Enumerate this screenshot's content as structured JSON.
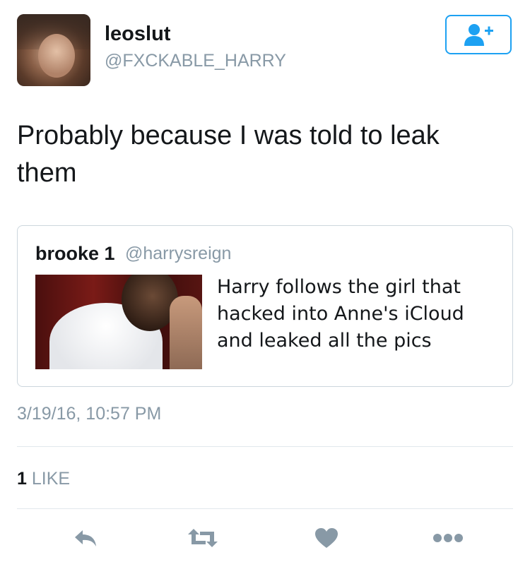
{
  "user": {
    "display_name": "leoslut",
    "handle": "@FXCKABLE_HARRY"
  },
  "follow_button": {
    "icon": "add-user-icon"
  },
  "tweet": {
    "text_line1": "Probably because I was told to leak",
    "text_line2": "them"
  },
  "quoted_tweet": {
    "name": "brooke 1",
    "handle": "@harrysreign",
    "text_line1": "Harry follows the girl that",
    "text_line2": "hacked into Anne's iCloud",
    "text_line3": "and leaked all the pics"
  },
  "timestamp": "3/19/16, 10:57 PM",
  "stats": {
    "like_count": "1",
    "like_label": "LIKE"
  },
  "actions": {
    "reply_icon": "reply-icon",
    "retweet_icon": "retweet-icon",
    "like_icon": "heart-icon",
    "more_icon": "more-icon"
  },
  "colors": {
    "accent": "#1da1f2",
    "muted": "#8899a6",
    "icon": "#8899a6"
  }
}
